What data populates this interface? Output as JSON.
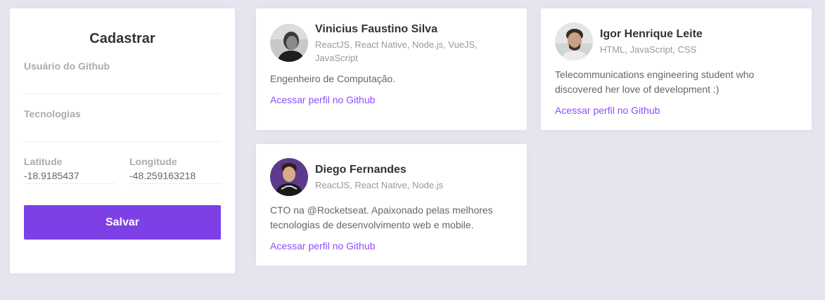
{
  "form": {
    "title": "Cadastrar",
    "github_user_label": "Usuário do Github",
    "github_user_value": "",
    "techs_label": "Tecnologias",
    "techs_value": "",
    "latitude_label": "Latitude",
    "latitude_value": "-18.9185437",
    "longitude_label": "Longitude",
    "longitude_value": "-48.259163218",
    "save_label": "Salvar"
  },
  "devs": [
    {
      "name": "Vinicius Faustino Silva",
      "techs": "ReactJS, React Native, Node.js, VueJS, JavaScript",
      "bio": "Engenheiro de Computação.",
      "link_label": "Acessar perfil no Github"
    },
    {
      "name": "Igor Henrique Leite",
      "techs": "HTML, JavaScript, CSS",
      "bio": "Telecommunications engineering student who discovered her love of development :)",
      "link_label": "Acessar perfil no Github"
    },
    {
      "name": "Diego Fernandes",
      "techs": "ReactJS, React Native, Node.js",
      "bio": "CTO na @Rocketseat. Apaixonado pelas melhores tecnologias de desenvolvimento web e mobile.",
      "link_label": "Acessar perfil no Github"
    }
  ],
  "colors": {
    "background": "#e6e5ef",
    "accent": "#7d40e7",
    "link": "#8e4dff"
  }
}
